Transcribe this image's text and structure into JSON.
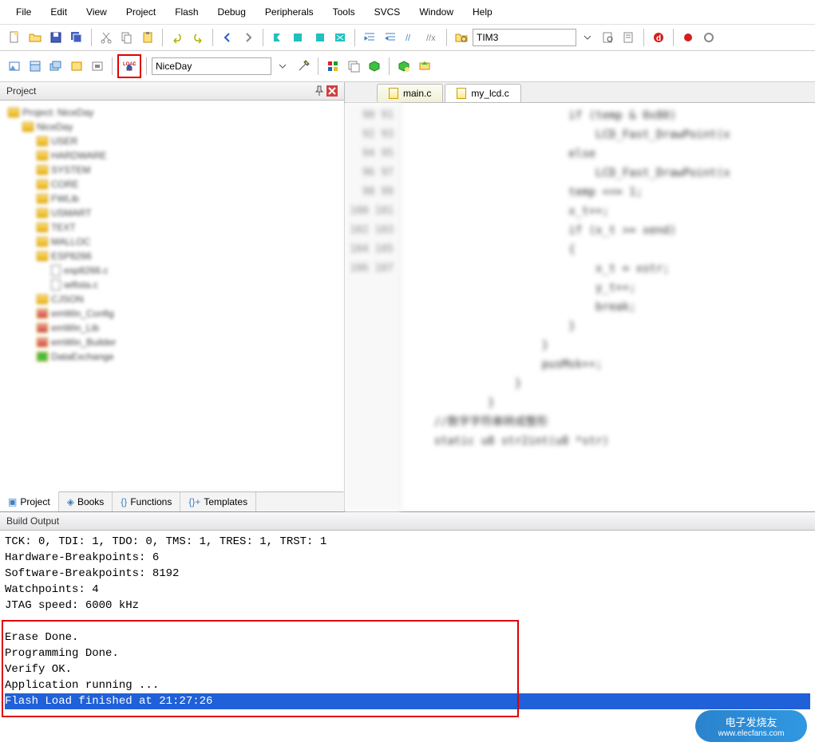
{
  "menu": [
    "File",
    "Edit",
    "View",
    "Project",
    "Flash",
    "Debug",
    "Peripherals",
    "Tools",
    "SVCS",
    "Window",
    "Help"
  ],
  "toolbar1": {
    "target": "TIM3"
  },
  "toolbar2": {
    "config": "NiceDay"
  },
  "projectPanel": {
    "title": "Project",
    "tree": [
      {
        "level": 1,
        "icon": "proj",
        "label": "Project: NiceDay"
      },
      {
        "level": 2,
        "icon": "target",
        "label": "NiceDay"
      },
      {
        "level": 3,
        "icon": "folder",
        "label": "USER"
      },
      {
        "level": 3,
        "icon": "folder",
        "label": "HARDWARE"
      },
      {
        "level": 3,
        "icon": "folder",
        "label": "SYSTEM"
      },
      {
        "level": 3,
        "icon": "folder",
        "label": "CORE"
      },
      {
        "level": 3,
        "icon": "folder",
        "label": "FWLib"
      },
      {
        "level": 3,
        "icon": "folder",
        "label": "USMART"
      },
      {
        "level": 3,
        "icon": "folder",
        "label": "TEXT"
      },
      {
        "level": 3,
        "icon": "folder",
        "label": "MALLOC"
      },
      {
        "level": 3,
        "icon": "folder",
        "label": "ESP8266"
      },
      {
        "level": 4,
        "icon": "file",
        "label": "esp8266.c"
      },
      {
        "level": 4,
        "icon": "file",
        "label": "wifista.c"
      },
      {
        "level": 3,
        "icon": "folder",
        "label": "CJSON"
      },
      {
        "level": 3,
        "icon": "group",
        "label": "emWin_Config"
      },
      {
        "level": 3,
        "icon": "group",
        "label": "emWin_Lib"
      },
      {
        "level": 3,
        "icon": "group",
        "label": "emWin_Builder"
      },
      {
        "level": 3,
        "icon": "green",
        "label": "DataExchange"
      }
    ]
  },
  "panelTabs": [
    "Project",
    "Books",
    "Functions",
    "Templates"
  ],
  "editorTabs": [
    {
      "label": "main.c",
      "active": false
    },
    {
      "label": "my_lcd.c",
      "active": true
    }
  ],
  "lineStart": 90,
  "lineEnd": 107,
  "codeLines": [
    "                        if (temp & 0x80)",
    "                            LCD_Fast_DrawPoint(x",
    "                        else",
    "                            LCD_Fast_DrawPoint(x",
    "                        temp <<= 1;",
    "                        x_t++;",
    "                        if (x_t >= xend)",
    "                        {",
    "                            x_t = xstr;",
    "                            y_t++;",
    "                            break;",
    "                        }",
    "                    }",
    "                    pusMsk++;",
    "                }",
    "            }",
    "    //数字字符串转成整形",
    "    static u8 str2int(u8 *str)"
  ],
  "buildHeader": "Build Output",
  "buildLines": [
    "TCK: 0, TDI: 1, TDO: 0, TMS: 1, TRES: 1, TRST: 1",
    "Hardware-Breakpoints: 6",
    "Software-Breakpoints: 8192",
    "Watchpoints:          4",
    "JTAG speed: 6000 kHz",
    "",
    "Erase Done.",
    "Programming Done.",
    "Verify OK.",
    "Application running ...",
    "Flash Load finished at 21:27:26"
  ],
  "watermark": {
    "title": "电子发烧友",
    "url": "www.elecfans.com"
  }
}
